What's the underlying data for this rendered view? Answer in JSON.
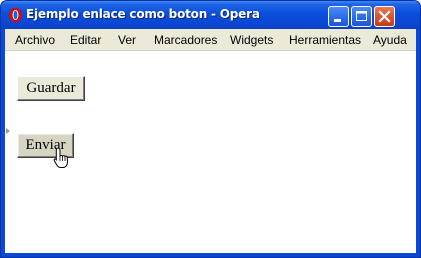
{
  "window": {
    "title": "Ejemplo enlace como boton - Opera"
  },
  "titlebar_buttons": {
    "minimize": "minimize-icon",
    "maximize": "maximize-icon",
    "close": "close-icon"
  },
  "menu": {
    "items": [
      "Archivo",
      "Editar",
      "Ver",
      "Marcadores",
      "Widgets",
      "Herramientas",
      "Ayuda"
    ]
  },
  "page": {
    "guardar_label": "Guardar",
    "enviar_label": "Enviar"
  },
  "colors": {
    "titlebar": "#0a4fdc",
    "menubar": "#ece9d8",
    "close_button": "#d8532c"
  }
}
